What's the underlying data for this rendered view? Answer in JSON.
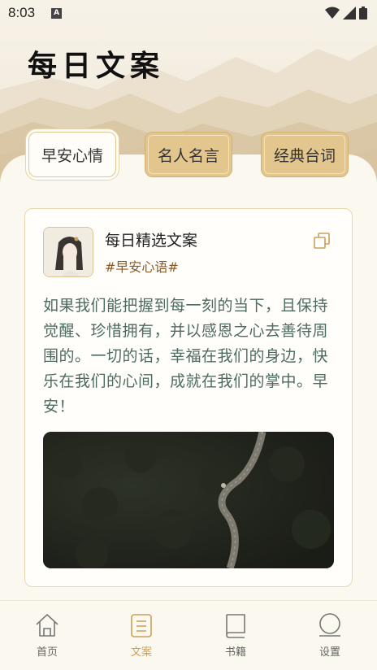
{
  "status_bar": {
    "time": "8:03",
    "notification_badge": "A"
  },
  "app": {
    "title": "每日文案"
  },
  "tabs": [
    {
      "label": "早安心情",
      "active": true
    },
    {
      "label": "名人名言",
      "active": false
    },
    {
      "label": "经典台词",
      "active": false
    }
  ],
  "card": {
    "title": "每日精选文案",
    "tag": "#早安心语#",
    "text": "如果我们能把握到每一刻的当下，且保持觉醒、珍惜拥有，并以感恩之心去善待周围的。一切的话，幸福在我们的身边，快乐在我们的心间，成就在我们的掌中。早安！"
  },
  "bottom_nav": [
    {
      "label": "首页",
      "icon": "home-icon",
      "active": false
    },
    {
      "label": "文案",
      "icon": "document-icon",
      "active": true
    },
    {
      "label": "书籍",
      "icon": "book-icon",
      "active": false
    },
    {
      "label": "设置",
      "icon": "settings-icon",
      "active": false
    }
  ],
  "colors": {
    "accent": "#c9a05c",
    "tab_inactive": "#e3c68d",
    "text_green": "#4d6b60",
    "background": "#fbf8ef"
  }
}
